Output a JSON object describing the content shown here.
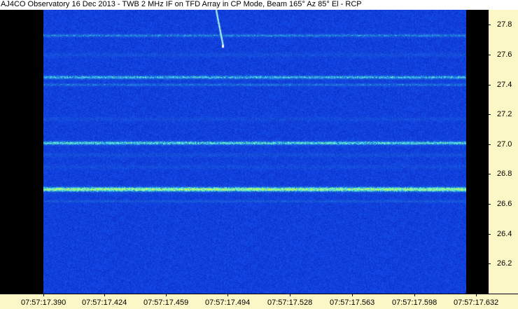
{
  "title": "AJ4CO Observatory 16 Dec 2013 - TWB 2 MHz IF on TFD Array in CP Mode, Beam 165° Az 85° El - RCP",
  "colors": {
    "background": "#1e44e0",
    "axis_bg": "#fbf7c6",
    "mask": "#000000"
  },
  "y_axis": {
    "unit_hint": "",
    "range": [
      26.0,
      27.9
    ],
    "ticks": [
      "27.8",
      "27.6",
      "27.4",
      "27.2",
      "27.0",
      "26.8",
      "26.6",
      "26.4",
      "26.2"
    ],
    "tick_values": [
      27.8,
      27.6,
      27.4,
      27.2,
      27.0,
      26.8,
      26.6,
      26.4,
      26.2
    ]
  },
  "x_axis": {
    "ticks": [
      "07:57:17.390",
      "07:57:17.424",
      "07:57:17.459",
      "07:57:17.494",
      "07:57:17.528",
      "07:57:17.563",
      "07:57:17.598",
      "07:57:17.632"
    ]
  },
  "spectrogram": {
    "bands_mhz": [
      27.73,
      27.45,
      27.4,
      27.01,
      26.7,
      26.62
    ],
    "burst": {
      "freq_start_mhz": 27.95,
      "freq_end_mhz": 27.66
    }
  }
}
